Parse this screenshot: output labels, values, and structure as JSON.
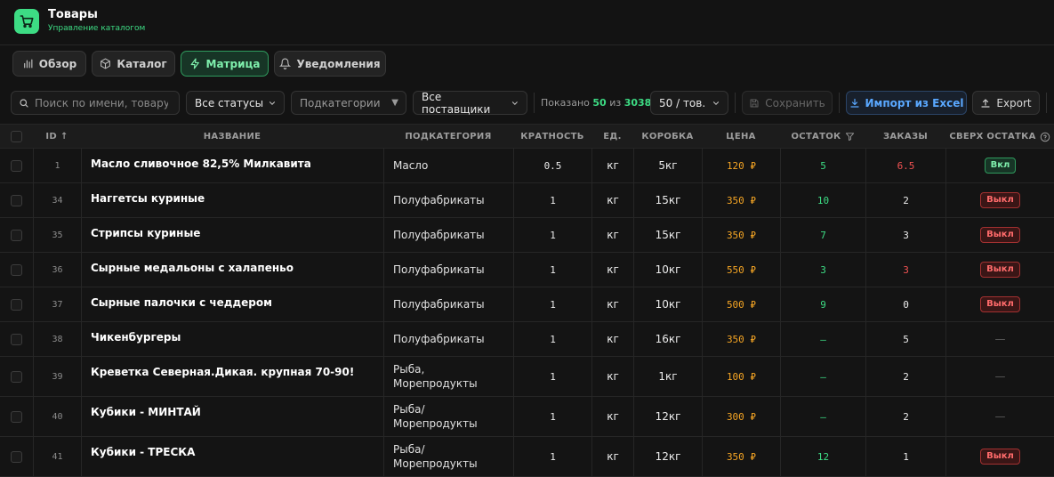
{
  "app": {
    "title": "Товары",
    "subtitle": "Управление каталогом",
    "icon": "cart-icon",
    "accent": "#3ddc84"
  },
  "tabs": [
    {
      "label": "Обзор",
      "icon": "bar-chart-icon",
      "active": false
    },
    {
      "label": "Каталог",
      "icon": "box-icon",
      "active": false
    },
    {
      "label": "Матрица",
      "icon": "lightning-icon",
      "active": true
    },
    {
      "label": "Уведомления",
      "icon": "bell-icon",
      "active": false
    }
  ],
  "toolbar": {
    "search_placeholder": "Поиск по имени, товару, а",
    "status_filter": "Все статусы",
    "subcategory_filter": "Подкатегории",
    "supplier_filter": "Все поставщики",
    "shown_prefix": "Показано",
    "shown_count": "50",
    "shown_mid": "из",
    "shown_total": "3038",
    "page_size": "50 / тов.",
    "save_label": "Сохранить",
    "import_label": "Импорт из Excel",
    "export_label": "Export"
  },
  "columns": {
    "id": "ID",
    "name": "НАЗВАНИЕ",
    "subcategory": "ПОДКАТЕГОРИЯ",
    "multiplicity": "КРАТНОСТЬ",
    "unit": "ЕД.",
    "box": "КОРОБКА",
    "price": "ЦЕНА",
    "stock": "ОСТАТОК",
    "orders": "ЗАКАЗЫ",
    "over_stock": "СВЕРХ ОСТАТКА"
  },
  "rows": [
    {
      "id": "1",
      "name": "Масло сливочное 82,5% Милкавита",
      "subcategory": [
        "Масло"
      ],
      "multiplicity": "0.5",
      "unit": "кг",
      "box": "5кг",
      "price": "120 ₽",
      "stock": "5",
      "stock_color": "green",
      "orders": "6.5",
      "orders_color": "red",
      "over": "Вкл",
      "over_state": "on"
    },
    {
      "id": "34",
      "name": "Наггетсы куриные",
      "subcategory": [
        "Полуфабрикаты"
      ],
      "multiplicity": "1",
      "unit": "кг",
      "box": "15кг",
      "price": "350 ₽",
      "stock": "10",
      "stock_color": "green",
      "orders": "2",
      "orders_color": "white",
      "over": "Выкл",
      "over_state": "off"
    },
    {
      "id": "35",
      "name": "Стрипсы куриные",
      "subcategory": [
        "Полуфабрикаты"
      ],
      "multiplicity": "1",
      "unit": "кг",
      "box": "15кг",
      "price": "350 ₽",
      "stock": "7",
      "stock_color": "green",
      "orders": "3",
      "orders_color": "white",
      "over": "Выкл",
      "over_state": "off"
    },
    {
      "id": "36",
      "name": "Сырные медальоны с халапеньо",
      "subcategory": [
        "Полуфабрикаты"
      ],
      "multiplicity": "1",
      "unit": "кг",
      "box": "10кг",
      "price": "550 ₽",
      "stock": "3",
      "stock_color": "green",
      "orders": "3",
      "orders_color": "red",
      "over": "Выкл",
      "over_state": "off"
    },
    {
      "id": "37",
      "name": "Сырные палочки с чеддером",
      "subcategory": [
        "Полуфабрикаты"
      ],
      "multiplicity": "1",
      "unit": "кг",
      "box": "10кг",
      "price": "500 ₽",
      "stock": "9",
      "stock_color": "green",
      "orders": "0",
      "orders_color": "white",
      "over": "Выкл",
      "over_state": "off"
    },
    {
      "id": "38",
      "name": "Чикенбургеры",
      "subcategory": [
        "Полуфабрикаты"
      ],
      "multiplicity": "1",
      "unit": "кг",
      "box": "16кг",
      "price": "350 ₽",
      "stock": "—",
      "stock_color": "green",
      "orders": "5",
      "orders_color": "white",
      "over": "—",
      "over_state": "none"
    },
    {
      "id": "39",
      "name": "Креветка Северная.Дикая. крупная 70-90!",
      "subcategory": [
        "Рыба,",
        "Морепродукты"
      ],
      "multiplicity": "1",
      "unit": "кг",
      "box": "1кг",
      "price": "100 ₽",
      "stock": "—",
      "stock_color": "green",
      "orders": "2",
      "orders_color": "white",
      "over": "—",
      "over_state": "none"
    },
    {
      "id": "40",
      "name": "Кубики - МИНТАЙ",
      "subcategory": [
        "Рыба/",
        "Морепродукты"
      ],
      "multiplicity": "1",
      "unit": "кг",
      "box": "12кг",
      "price": "300 ₽",
      "stock": "—",
      "stock_color": "green",
      "orders": "2",
      "orders_color": "white",
      "over": "—",
      "over_state": "none"
    },
    {
      "id": "41",
      "name": "Кубики - ТРЕСКА",
      "subcategory": [
        "Рыба/",
        "Морепродукты"
      ],
      "multiplicity": "1",
      "unit": "кг",
      "box": "12кг",
      "price": "350 ₽",
      "stock": "12",
      "stock_color": "green",
      "orders": "1",
      "orders_color": "white",
      "over": "Выкл",
      "over_state": "off"
    }
  ]
}
